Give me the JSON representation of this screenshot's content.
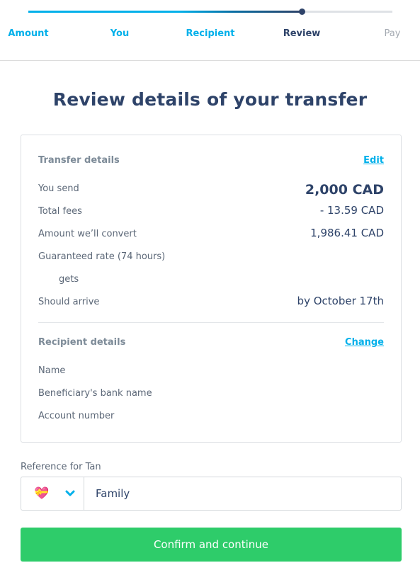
{
  "stepper": {
    "progress_step_index": 3,
    "steps": [
      {
        "label": "Amount",
        "state": "done"
      },
      {
        "label": "You",
        "state": "done"
      },
      {
        "label": "Recipient",
        "state": "done"
      },
      {
        "label": "Review",
        "state": "active"
      },
      {
        "label": "Pay",
        "state": "todo"
      }
    ]
  },
  "page": {
    "title": "Review details of your transfer"
  },
  "transfer_details": {
    "heading": "Transfer details",
    "edit_label": "Edit",
    "rows": [
      {
        "label": "You send",
        "value": "2,000 CAD"
      },
      {
        "label": "Total fees",
        "value": "- 13.59 CAD"
      },
      {
        "label": "Amount we’ll convert",
        "value": "1,986.41 CAD"
      },
      {
        "label": "Guaranteed rate (74 hours)",
        "value": ""
      },
      {
        "label": "gets",
        "value": ""
      },
      {
        "label": "Should arrive",
        "value": "by October 17th"
      }
    ]
  },
  "recipient_details": {
    "heading": "Recipient details",
    "change_label": "Change",
    "rows": [
      {
        "label": "Name",
        "value": ""
      },
      {
        "label": "Beneficiary's bank name",
        "value": ""
      },
      {
        "label": "Account number",
        "value": ""
      }
    ]
  },
  "reference": {
    "label": "Reference for Tan",
    "emoji": "💝",
    "emoji_icon": "heart-with-ribbon",
    "value": "Family"
  },
  "actions": {
    "confirm_label": "Confirm and continue"
  },
  "colors": {
    "accent": "#00b0ea",
    "navy": "#2e4369",
    "confirm": "#2ecc6a",
    "muted": "#a3a9b1"
  }
}
